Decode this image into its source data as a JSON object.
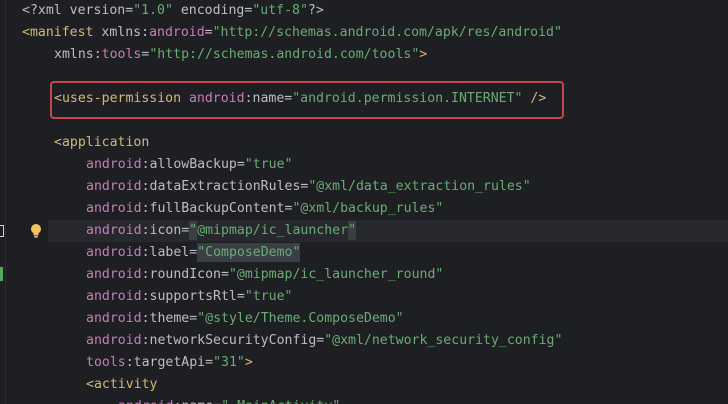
{
  "editor": {
    "lines": [
      {
        "indent": 0,
        "parts": [
          {
            "t": "<?",
            "c": "pi"
          },
          {
            "t": "xml ",
            "c": "pi"
          },
          {
            "t": "version",
            "c": "attr"
          },
          {
            "t": "=",
            "c": "attr"
          },
          {
            "t": "\"1.0\"",
            "c": "val"
          },
          {
            "t": " encoding",
            "c": "attr"
          },
          {
            "t": "=",
            "c": "attr"
          },
          {
            "t": "\"utf-8\"",
            "c": "val"
          },
          {
            "t": "?>",
            "c": "pi"
          }
        ]
      },
      {
        "indent": 0,
        "parts": [
          {
            "t": "<manifest ",
            "c": "tag"
          },
          {
            "t": "xmlns",
            "c": "attr"
          },
          {
            "t": ":",
            "c": "attr"
          },
          {
            "t": "android",
            "c": "ns"
          },
          {
            "t": "=",
            "c": "attr"
          },
          {
            "t": "\"http://schemas.android.com/apk/res/android\"",
            "c": "val"
          }
        ]
      },
      {
        "indent": 1,
        "parts": [
          {
            "t": "xmlns",
            "c": "attr"
          },
          {
            "t": ":",
            "c": "attr"
          },
          {
            "t": "tools",
            "c": "ns"
          },
          {
            "t": "=",
            "c": "attr"
          },
          {
            "t": "\"http://schemas.android.com/tools\"",
            "c": "val"
          },
          {
            "t": ">",
            "c": "tag"
          }
        ]
      },
      {
        "indent": 0,
        "parts": []
      },
      {
        "indent": 1,
        "parts": [
          {
            "t": "<uses-permission ",
            "c": "tag"
          },
          {
            "t": "android",
            "c": "ns"
          },
          {
            "t": ":",
            "c": "attr"
          },
          {
            "t": "name",
            "c": "attr"
          },
          {
            "t": "=",
            "c": "attr"
          },
          {
            "t": "\"android.permission.INTERNET\"",
            "c": "val"
          },
          {
            "t": " />",
            "c": "tag"
          }
        ]
      },
      {
        "indent": 0,
        "parts": []
      },
      {
        "indent": 1,
        "parts": [
          {
            "t": "<application",
            "c": "tag"
          }
        ]
      },
      {
        "indent": 2,
        "parts": [
          {
            "t": "android",
            "c": "ns"
          },
          {
            "t": ":",
            "c": "attr"
          },
          {
            "t": "allowBackup",
            "c": "attr"
          },
          {
            "t": "=",
            "c": "attr"
          },
          {
            "t": "\"true\"",
            "c": "val"
          }
        ]
      },
      {
        "indent": 2,
        "parts": [
          {
            "t": "android",
            "c": "ns"
          },
          {
            "t": ":",
            "c": "attr"
          },
          {
            "t": "dataExtractionRules",
            "c": "attr"
          },
          {
            "t": "=",
            "c": "attr"
          },
          {
            "t": "\"@xml/data_extraction_rules\"",
            "c": "val"
          }
        ]
      },
      {
        "indent": 2,
        "parts": [
          {
            "t": "android",
            "c": "ns"
          },
          {
            "t": ":",
            "c": "attr"
          },
          {
            "t": "fullBackupContent",
            "c": "attr"
          },
          {
            "t": "=",
            "c": "attr"
          },
          {
            "t": "\"@xml/backup_rules\"",
            "c": "val"
          }
        ]
      },
      {
        "indent": 2,
        "caret": true,
        "parts": [
          {
            "t": "android",
            "c": "ns"
          },
          {
            "t": ":",
            "c": "attr"
          },
          {
            "t": "icon",
            "c": "attr"
          },
          {
            "t": "=",
            "c": "attr"
          },
          {
            "t": "\"",
            "c": "val",
            "sel": true
          },
          {
            "t": "@mipmap/ic_launcher",
            "c": "val"
          },
          {
            "t": "\"",
            "c": "val",
            "sel": true
          }
        ]
      },
      {
        "indent": 2,
        "parts": [
          {
            "t": "android",
            "c": "ns"
          },
          {
            "t": ":",
            "c": "attr"
          },
          {
            "t": "label",
            "c": "attr"
          },
          {
            "t": "=",
            "c": "attr"
          },
          {
            "t": "\"ComposeDemo\"",
            "c": "val",
            "sel": true
          }
        ]
      },
      {
        "indent": 2,
        "parts": [
          {
            "t": "android",
            "c": "ns"
          },
          {
            "t": ":",
            "c": "attr"
          },
          {
            "t": "roundIcon",
            "c": "attr"
          },
          {
            "t": "=",
            "c": "attr"
          },
          {
            "t": "\"@mipmap/ic_launcher_round\"",
            "c": "val"
          }
        ]
      },
      {
        "indent": 2,
        "parts": [
          {
            "t": "android",
            "c": "ns"
          },
          {
            "t": ":",
            "c": "attr"
          },
          {
            "t": "supportsRtl",
            "c": "attr"
          },
          {
            "t": "=",
            "c": "attr"
          },
          {
            "t": "\"true\"",
            "c": "val"
          }
        ]
      },
      {
        "indent": 2,
        "parts": [
          {
            "t": "android",
            "c": "ns"
          },
          {
            "t": ":",
            "c": "attr"
          },
          {
            "t": "theme",
            "c": "attr"
          },
          {
            "t": "=",
            "c": "attr"
          },
          {
            "t": "\"@style/Theme.ComposeDemo\"",
            "c": "val"
          }
        ]
      },
      {
        "indent": 2,
        "parts": [
          {
            "t": "android",
            "c": "ns"
          },
          {
            "t": ":",
            "c": "attr"
          },
          {
            "t": "networkSecurityConfig",
            "c": "attr"
          },
          {
            "t": "=",
            "c": "attr"
          },
          {
            "t": "\"@xml/network_security_config\"",
            "c": "val"
          }
        ]
      },
      {
        "indent": 2,
        "parts": [
          {
            "t": "tools",
            "c": "ns"
          },
          {
            "t": ":",
            "c": "attr"
          },
          {
            "t": "targetApi",
            "c": "attr"
          },
          {
            "t": "=",
            "c": "attr"
          },
          {
            "t": "\"31\"",
            "c": "val"
          },
          {
            "t": ">",
            "c": "tag"
          }
        ]
      },
      {
        "indent": 2,
        "parts": [
          {
            "t": "<activity",
            "c": "tag"
          }
        ]
      },
      {
        "indent": 3,
        "parts": [
          {
            "t": "android",
            "c": "ns"
          },
          {
            "t": ":",
            "c": "attr"
          },
          {
            "t": "name",
            "c": "attr"
          },
          {
            "t": "=",
            "c": "attr"
          },
          {
            "t": "\".MainActivity\"",
            "c": "val"
          }
        ]
      }
    ]
  },
  "colors": {
    "background": "#1e1f22",
    "tag": "#d5b778",
    "namespace": "#c77dbb",
    "value": "#6aab73",
    "text": "#bcbec4",
    "highlight_border": "#c9454d",
    "vcs_added": "#56a85a"
  },
  "icons": {
    "lightbulb": "lightbulb-icon",
    "gutter_marker": "bookmark-icon"
  }
}
